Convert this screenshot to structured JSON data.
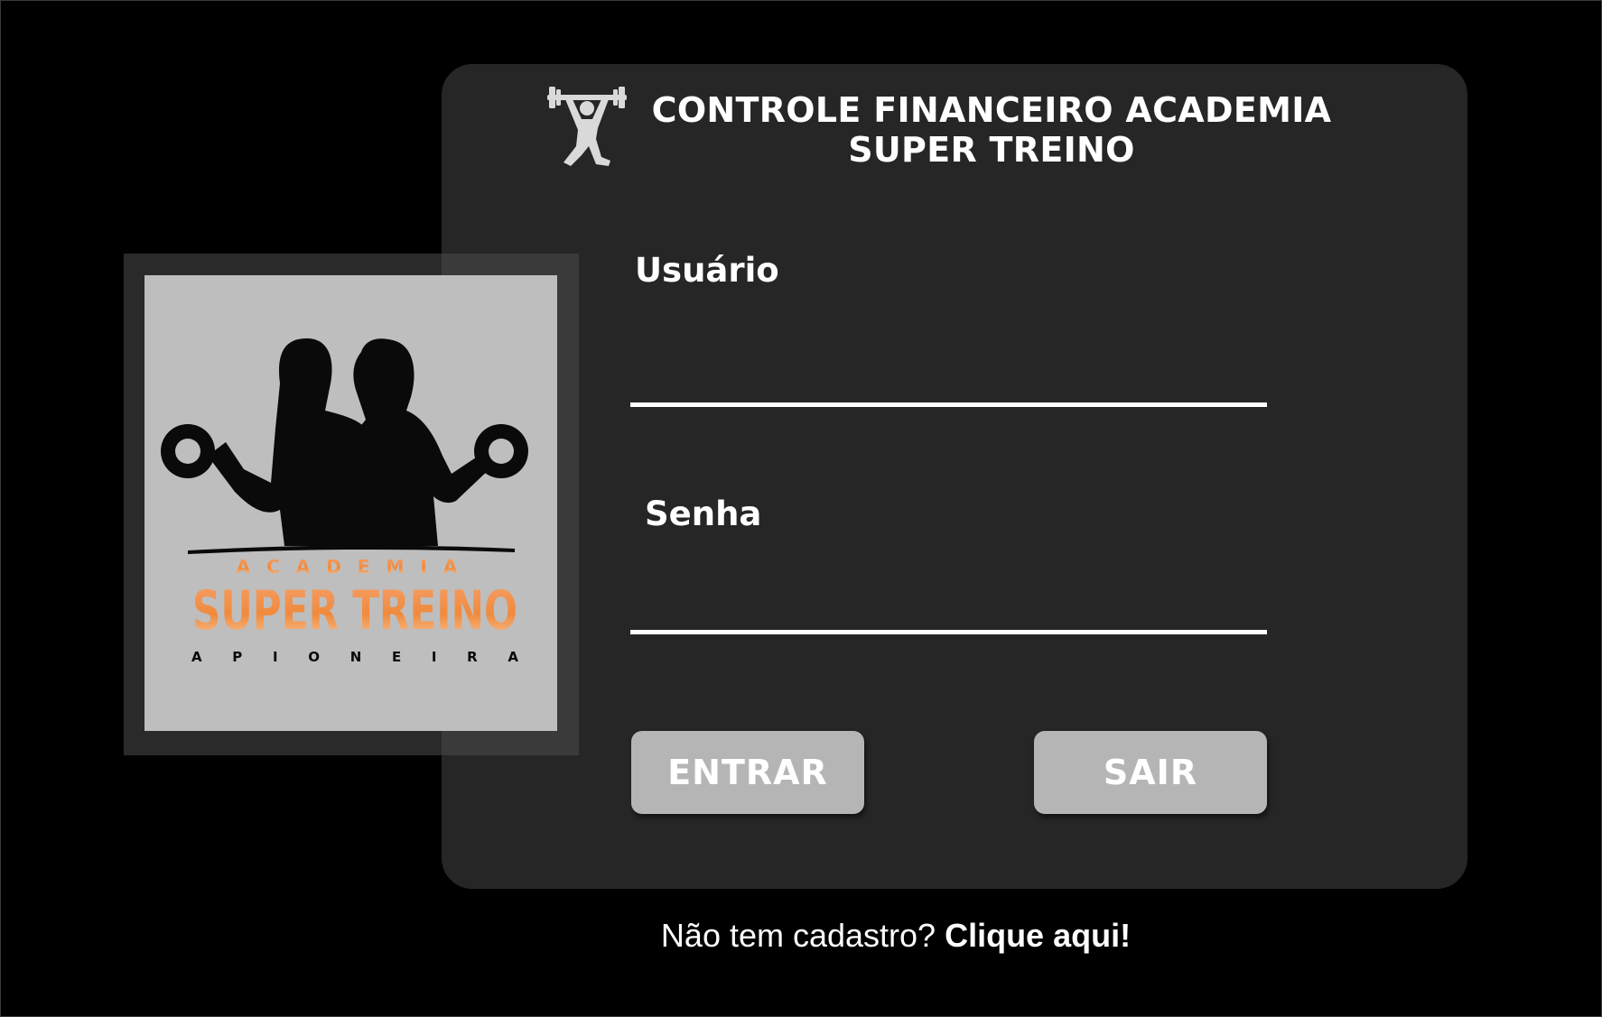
{
  "header": {
    "title_line1": "CONTROLE FINANCEIRO ACADEMIA",
    "title_line2": "SUPER TREINO",
    "icon": "weightlifter-icon"
  },
  "logo": {
    "small_top_text": "ACADEMIA",
    "brand": "SUPER TREINO",
    "tagline": "A P I O N E I R A",
    "brand_color": "#f08a3c"
  },
  "form": {
    "username_label": "Usuário",
    "username_value": "",
    "password_label": "Senha",
    "password_value": ""
  },
  "buttons": {
    "enter_label": "ENTRAR",
    "exit_label": "SAIR"
  },
  "footer": {
    "prompt": "Não tem cadastro? ",
    "link": "Clique aqui!"
  },
  "colors": {
    "background": "#000000",
    "panel": "#262626",
    "button": "#b5b5b5",
    "logo_card": "#bebebe"
  }
}
